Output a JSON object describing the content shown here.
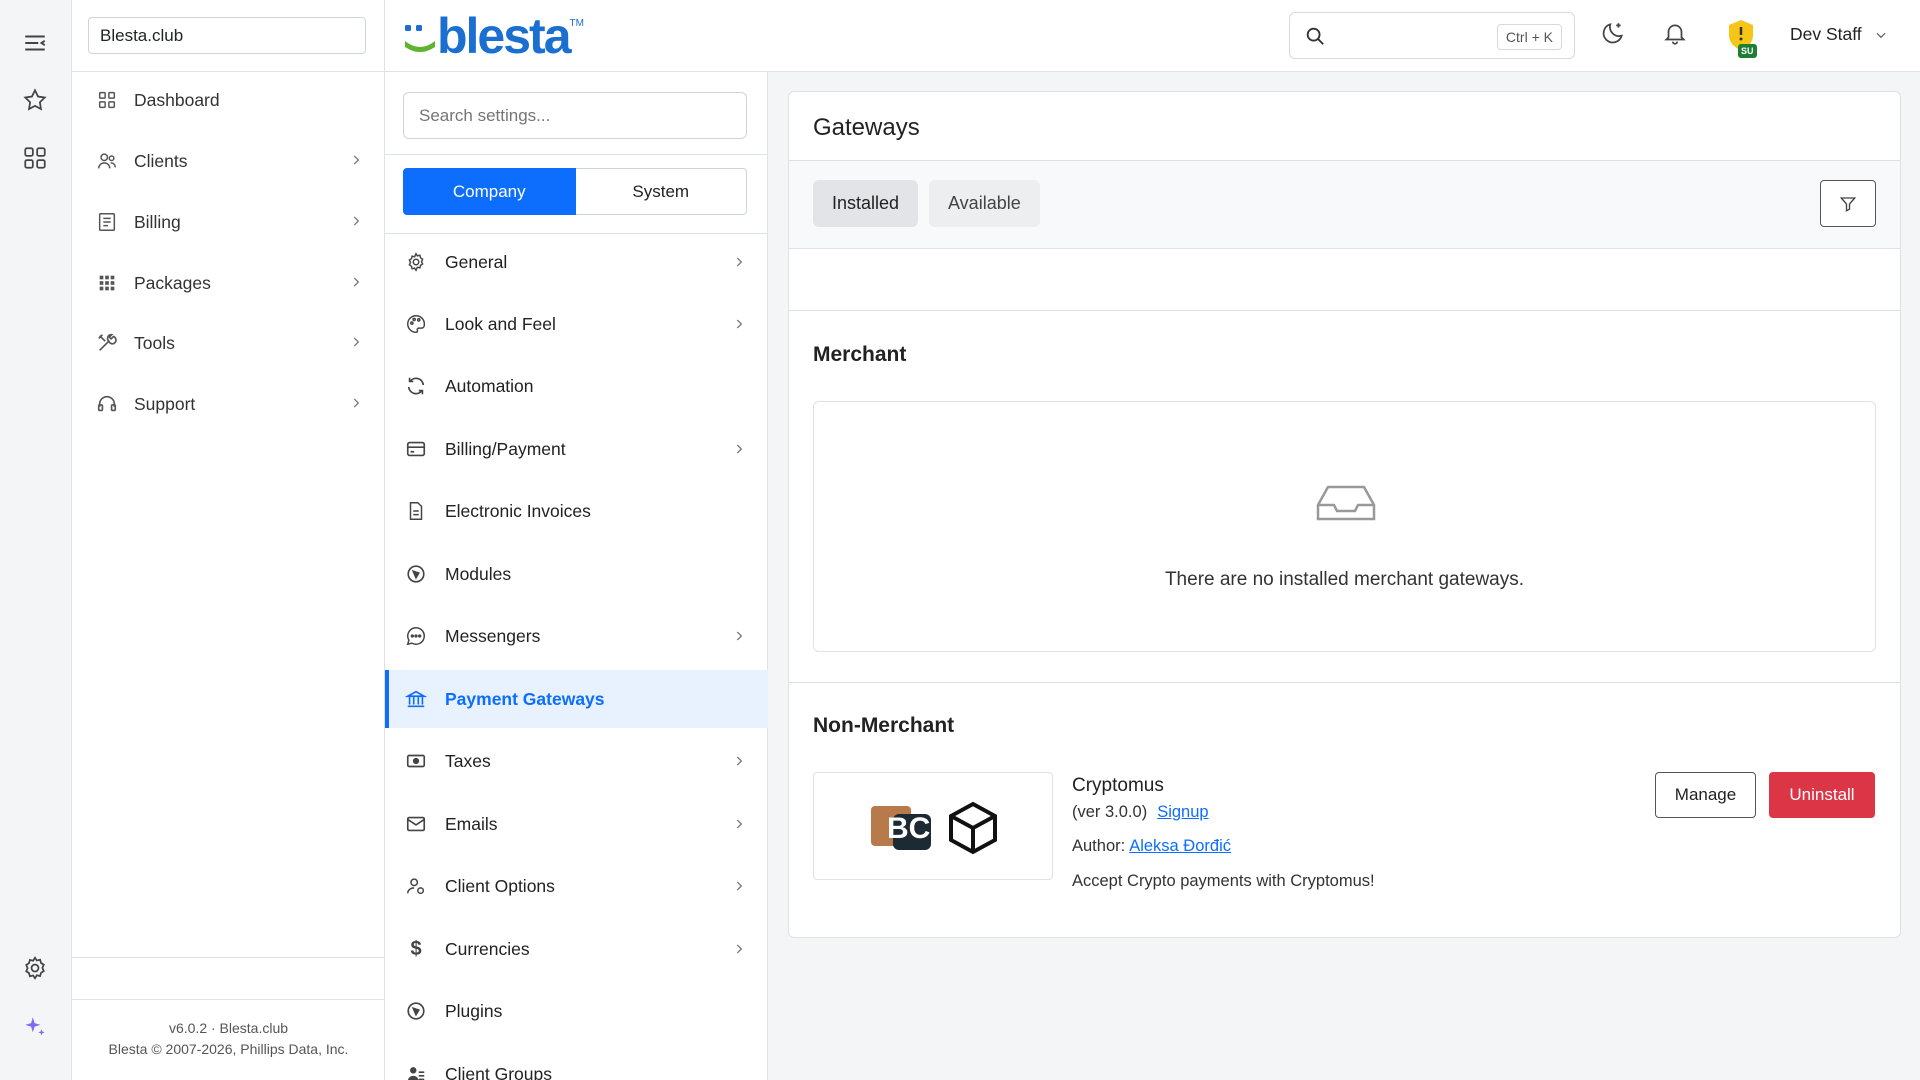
{
  "company": "Blesta.club",
  "nav": {
    "items": [
      {
        "label": "Dashboard"
      },
      {
        "label": "Clients"
      },
      {
        "label": "Billing"
      },
      {
        "label": "Packages"
      },
      {
        "label": "Tools"
      },
      {
        "label": "Support"
      }
    ],
    "footer_version": "v6.0.2 · Blesta.club",
    "footer_copyright": "Blesta © 2007-2026, Phillips Data, Inc."
  },
  "header": {
    "logo": "blesta",
    "logo_tm": "TM",
    "search_shortcut": "Ctrl + K",
    "badge": "SU",
    "user": "Dev Staff"
  },
  "settings": {
    "search_placeholder": "Search settings...",
    "seg_company": "Company",
    "seg_system": "System",
    "items": [
      {
        "label": "General"
      },
      {
        "label": "Look and Feel"
      },
      {
        "label": "Automation"
      },
      {
        "label": "Billing/Payment"
      },
      {
        "label": "Electronic Invoices"
      },
      {
        "label": "Modules"
      },
      {
        "label": "Messengers"
      },
      {
        "label": "Payment Gateways"
      },
      {
        "label": "Taxes"
      },
      {
        "label": "Emails"
      },
      {
        "label": "Client Options"
      },
      {
        "label": "Currencies"
      },
      {
        "label": "Plugins"
      },
      {
        "label": "Client Groups"
      }
    ]
  },
  "main": {
    "title": "Gateways",
    "tab_installed": "Installed",
    "tab_available": "Available",
    "merchant_title": "Merchant",
    "merchant_empty": "There are no installed merchant gateways.",
    "nonmerchant_title": "Non-Merchant",
    "gateway": {
      "name": "Cryptomus",
      "version": "(ver 3.0.0)",
      "signup": "Signup",
      "author_label": "Author:",
      "author": "Aleksa Đorđić",
      "description": "Accept Crypto payments with Cryptomus!",
      "logo_text": "BC",
      "manage": "Manage",
      "uninstall": "Uninstall"
    }
  }
}
